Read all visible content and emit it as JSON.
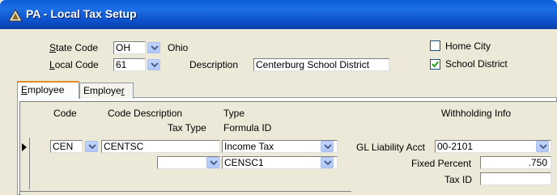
{
  "window": {
    "title": "PA - Local Tax Setup"
  },
  "header": {
    "state_code_label_pre": "S",
    "state_code_label_post": "tate Code",
    "state_code_value": "OH",
    "state_name": "Ohio",
    "local_code_label_pre": "L",
    "local_code_label_post": "ocal Code",
    "local_code_value": "61",
    "description_label": "Description",
    "description_value": "Centerburg School District",
    "home_city_label": "Home City",
    "home_city_checked": false,
    "school_district_label": "School District",
    "school_district_checked": true
  },
  "tabs": [
    {
      "label_pre": "E",
      "label_post": "mployee",
      "active": true
    },
    {
      "label_pre": "Employe",
      "label_u": "r",
      "label_post": "",
      "active": false
    }
  ],
  "grid": {
    "headers": {
      "code": "Code",
      "code_description": "Code Description",
      "type": "Type",
      "withholding_info": "Withholding Info",
      "tax_type": "Tax Type",
      "formula_id": "Formula ID"
    },
    "row": {
      "code": "CEN",
      "code_description": "CENTSC",
      "type": "Income Tax",
      "tax_type": "",
      "formula_id": "CENSC1",
      "gl_liability_label": "GL Liability Acct",
      "gl_liability_value": "00-2101",
      "fixed_percent_label": "Fixed Percent",
      "fixed_percent_value": ".750",
      "tax_id_label": "Tax ID",
      "tax_id_value": ""
    }
  },
  "colors": {
    "titlebar": "#0a5ad8",
    "active_tab_accent": "#e68b2c",
    "dropdown_button": "#b1c8fa"
  }
}
